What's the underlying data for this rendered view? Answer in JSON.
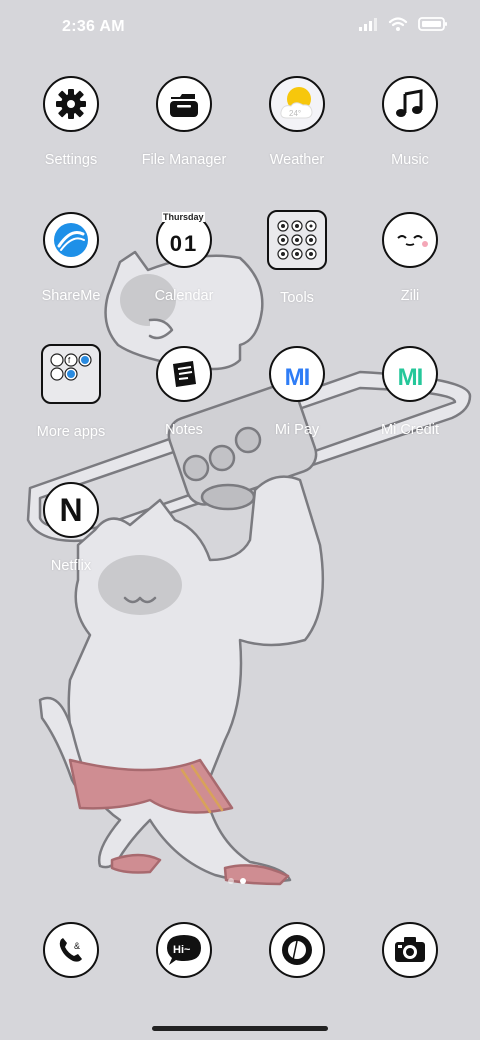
{
  "status_bar": {
    "time": "2:36 AM"
  },
  "apps": [
    {
      "label": "Settings",
      "icon": "settings-gear-icon"
    },
    {
      "label": "File Manager",
      "icon": "file-manager-icon"
    },
    {
      "label": "Weather",
      "icon": "weather-sun-cloud-icon",
      "badge": "24°"
    },
    {
      "label": "Music",
      "icon": "music-note-icon"
    },
    {
      "label": "ShareMe",
      "icon": "shareme-icon"
    },
    {
      "label": "Calendar",
      "icon": "calendar-icon",
      "day_label": "Thursday",
      "date": "01"
    },
    {
      "label": "Tools",
      "icon": "tools-folder-icon"
    },
    {
      "label": "Zili",
      "icon": "zili-face-icon"
    },
    {
      "label": "More apps",
      "icon": "more-apps-folder-icon"
    },
    {
      "label": "Notes",
      "icon": "notes-icon"
    },
    {
      "label": "Mi Pay",
      "icon": "mi-pay-icon",
      "mark": "MI"
    },
    {
      "label": "Mi Credit",
      "icon": "mi-credit-icon",
      "mark": "MI"
    },
    {
      "label": "Netflix",
      "icon": "netflix-icon",
      "mark": "N"
    }
  ],
  "dock": [
    {
      "icon": "phone-icon"
    },
    {
      "icon": "messages-icon",
      "mark": "Hi~"
    },
    {
      "icon": "browser-icon"
    },
    {
      "icon": "camera-icon"
    }
  ],
  "colors": {
    "background": "#d6d6da",
    "label": "#ffffff",
    "mi_pay": "#2f7df6",
    "mi_credit": "#25c79a",
    "shareme": "#1e90e8",
    "weather_sun": "#f7c70c"
  }
}
